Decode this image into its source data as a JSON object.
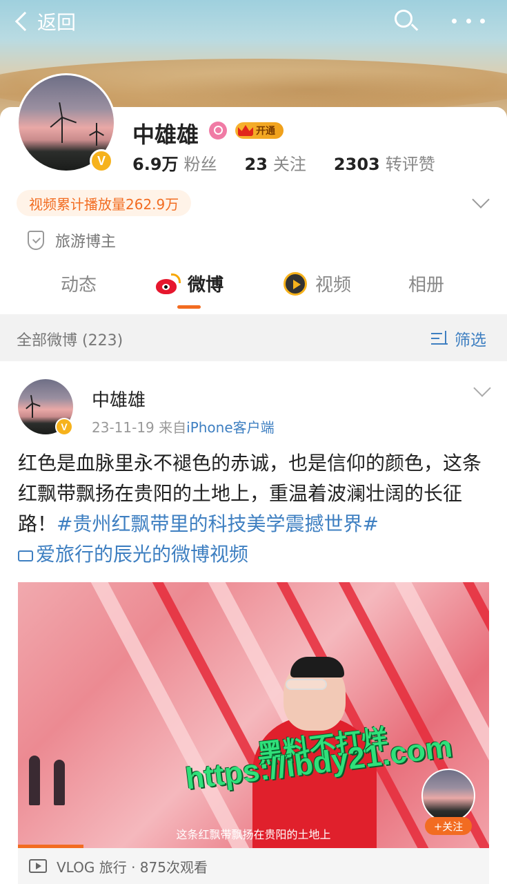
{
  "header": {
    "back_label": "返回"
  },
  "profile": {
    "name": "中雄雄",
    "vip_label": "开通",
    "stats": [
      {
        "num": "6.9万",
        "label": "粉丝"
      },
      {
        "num": "23",
        "label": "关注"
      },
      {
        "num": "2303",
        "label": "转评赞"
      }
    ],
    "play_count": "视频累计播放量262.9万",
    "role": "旅游博主"
  },
  "tabs": [
    {
      "label": "动态"
    },
    {
      "label": "微博"
    },
    {
      "label": "视频"
    },
    {
      "label": "相册"
    }
  ],
  "filter_bar": {
    "all_label": "全部微博 (223)",
    "filter_label": "筛选"
  },
  "post": {
    "author": "中雄雄",
    "date": "23-11-19",
    "source_prefix": "来自",
    "source": "iPhone客户端",
    "text": "红色是血脉里永不褪色的赤诚，也是信仰的颜色，这条红飘带飘扬在贵阳的土地上，重温着波澜壮阔的长征路！",
    "topic": "#贵州红飘带里的科技美学震撼世界#",
    "video_link": "爱旅行的辰光的微博视频",
    "video": {
      "subtitle": "这条红飘带飘扬在贵阳的土地上",
      "follow_label": "+关注",
      "footer": "VLOG 旅行 · 875次观看"
    }
  },
  "watermark": {
    "line1": "黑料不打烊",
    "line2": "https://ibdy21.com"
  },
  "colors": {
    "accent": "#f26c21",
    "link": "#3e7fc1",
    "verified": "#f6b21c"
  }
}
